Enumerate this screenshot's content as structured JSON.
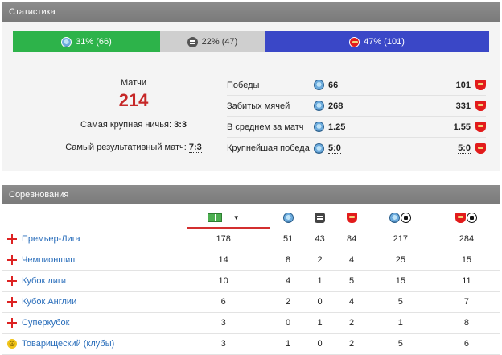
{
  "stats": {
    "header": "Статистика",
    "split": {
      "team1_wins": "31% (66)",
      "draws": "22% (47)",
      "team2_wins": "47% (101)",
      "colors": {
        "team1": "#2db34a",
        "draws": "#cfcfcf",
        "team2": "#3a47c7"
      }
    },
    "matches_label": "Матчи",
    "matches_total": "214",
    "biggest_draw_label": "Самая крупная ничья:",
    "biggest_draw_value": "3:3",
    "most_goals_label": "Самый результативный матч:",
    "most_goals_value": "7:3",
    "rows": [
      {
        "label": "Победы",
        "team1": "66",
        "team2": "101"
      },
      {
        "label": "Забитых мячей",
        "team1": "268",
        "team2": "331"
      },
      {
        "label": "В среднем за матч",
        "team1": "1.25",
        "team2": "1.55"
      },
      {
        "label": "Крупнейшая победа",
        "team1": "5:0",
        "team2": "5:0"
      }
    ],
    "icons": {
      "team1": "man-city-badge-icon",
      "draws": "draw-icon",
      "team2": "arsenal-badge-icon"
    }
  },
  "competitions": {
    "header": "Соревнования",
    "columns": [
      "matches-field-icon",
      "man-city-badge-icon",
      "draw-icon",
      "arsenal-badge-icon",
      "man-city-goals-icon",
      "arsenal-goals-icon"
    ],
    "sorted_column": 0,
    "rows": [
      {
        "name": "Премьер-Лига",
        "flag": "england-flag-icon",
        "values": [
          "178",
          "51",
          "43",
          "84",
          "217",
          "284"
        ]
      },
      {
        "name": "Чемпионшип",
        "flag": "england-flag-icon",
        "values": [
          "14",
          "8",
          "2",
          "4",
          "25",
          "15"
        ]
      },
      {
        "name": "Кубок лиги",
        "flag": "england-flag-icon",
        "values": [
          "10",
          "4",
          "1",
          "5",
          "15",
          "11"
        ]
      },
      {
        "name": "Кубок Англии",
        "flag": "england-flag-icon",
        "values": [
          "6",
          "2",
          "0",
          "4",
          "5",
          "7"
        ]
      },
      {
        "name": "Суперкубок",
        "flag": "england-flag-icon",
        "values": [
          "3",
          "0",
          "1",
          "2",
          "1",
          "8"
        ]
      },
      {
        "name": "Товарищеский (клубы)",
        "flag": "peace-icon",
        "values": [
          "3",
          "1",
          "0",
          "2",
          "5",
          "6"
        ]
      }
    ]
  }
}
